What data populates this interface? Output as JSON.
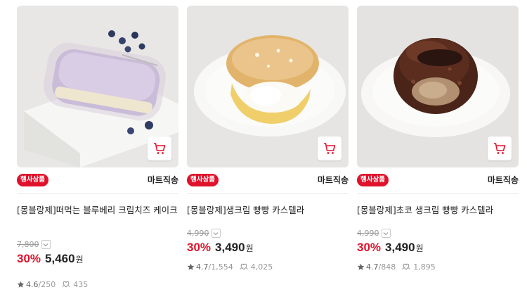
{
  "products": [
    {
      "badge": "행사상품",
      "seller": "마트직송",
      "title": "[몽블랑제]떠먹는 블루베리 크림치즈 케이크",
      "original_price": "7,800",
      "discount": "30%",
      "price": "5,460",
      "currency": "원",
      "rating": "4.6",
      "reviews": "250",
      "wishes": "435",
      "image": "blueberry-cream-cheese-cake-photo"
    },
    {
      "badge": "행사상품",
      "seller": "마트직송",
      "title": "[몽블랑제]생크림 빵빵 카스텔라",
      "original_price": "4,990",
      "discount": "30%",
      "price": "3,490",
      "currency": "원",
      "rating": "4.7",
      "reviews": "1,554",
      "wishes": "4,025",
      "image": "fresh-cream-castella-photo"
    },
    {
      "badge": "행사상품",
      "seller": "마트직송",
      "title": "[몽블랑제]초코 생크림 빵빵 카스텔라",
      "original_price": "4,990",
      "discount": "30%",
      "price": "3,490",
      "currency": "원",
      "rating": "4.7",
      "reviews": "848",
      "wishes": "1,895",
      "image": "chocolate-cream-castella-photo"
    }
  ],
  "colors": {
    "accent": "#e0122b",
    "text": "#222222",
    "muted": "#9a9a9a",
    "image_bg": "#e9e8e6"
  },
  "icons": {
    "cart": "cart-icon",
    "star": "star-icon",
    "wish": "wishlist-icon",
    "dropdown": "chevron-down-icon"
  }
}
